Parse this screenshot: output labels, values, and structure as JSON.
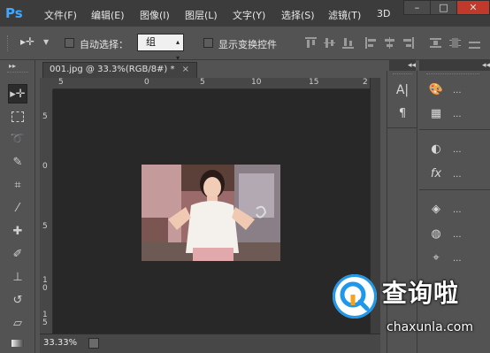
{
  "app": {
    "logo": "Ps"
  },
  "menu": [
    "文件(F)",
    "编辑(E)",
    "图像(I)",
    "图层(L)",
    "文字(Y)",
    "选择(S)",
    "滤镜(T)",
    "3D"
  ],
  "window_buttons": {
    "minimize": "–",
    "maximize": "□",
    "close": "✕"
  },
  "options_bar": {
    "auto_select_label": "自动选择：",
    "auto_select_value": "组",
    "show_transform_label": "显示变换控件"
  },
  "document": {
    "tab_title": "001.jpg @ 33.3%(RGB/8#) *",
    "tab_close": "×",
    "ruler_h": [
      "5",
      "0",
      "5",
      "10",
      "15",
      "2"
    ],
    "ruler_v": [
      "5",
      "0",
      "5",
      "1",
      "0",
      "1",
      "5"
    ],
    "zoom": "33.33%"
  },
  "panels": {
    "collapse": "◂◂",
    "expand": "▸▸",
    "dots": "..."
  },
  "watermark": {
    "text": "查询啦",
    "url": "chaxunla.com"
  }
}
